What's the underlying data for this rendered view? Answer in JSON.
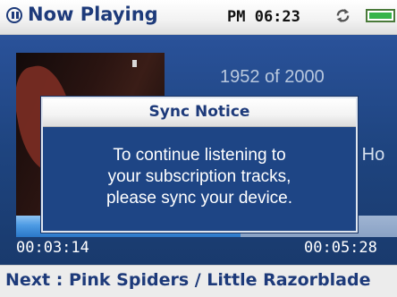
{
  "status_bar": {
    "title": "Now Playing",
    "clock": "PM 06:23",
    "icons": {
      "play_state": "pause-icon",
      "sync": "sync-icon",
      "battery": "battery-icon"
    }
  },
  "player": {
    "track_counter": "1952 of 2000",
    "track_title_partial": "e Ho",
    "progress": {
      "elapsed": "00:03:14",
      "total": "00:05:28",
      "fraction": 0.59
    }
  },
  "next_track": {
    "label": "Next : Pink Spiders / Little Razorblade"
  },
  "dialog": {
    "title": "Sync Notice",
    "message_lines": [
      "To continue listening to",
      "your subscription tracks,",
      "please sync your device."
    ]
  },
  "colors": {
    "header_text": "#1d3a7a",
    "player_bg": "#1e447f",
    "dialog_bg": "#1e4585",
    "progress_fill": "#4d9be4",
    "battery_green": "#35b44a"
  }
}
